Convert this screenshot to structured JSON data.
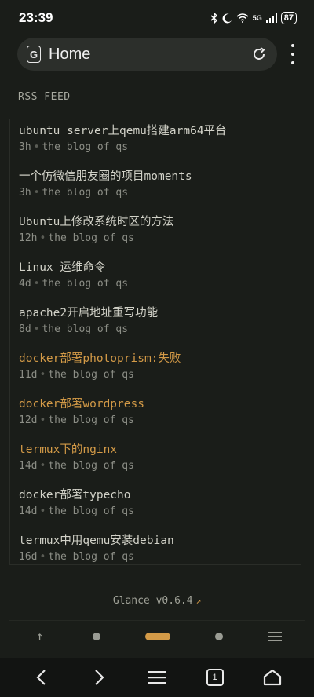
{
  "status_bar": {
    "time": "23:39",
    "network": "5G",
    "battery": "87"
  },
  "browser": {
    "url_text": "Home",
    "site_icon_letter": "G"
  },
  "section": {
    "title": "RSS FEED"
  },
  "feed": {
    "items": [
      {
        "title": "ubuntu server上qemu搭建arm64平台",
        "age": "3h",
        "source": "the blog of qs",
        "visited": false
      },
      {
        "title": "一个仿微信朋友圈的项目moments",
        "age": "3h",
        "source": "the blog of qs",
        "visited": false
      },
      {
        "title": "Ubuntu上修改系统时区的方法",
        "age": "12h",
        "source": "the blog of qs",
        "visited": false
      },
      {
        "title": "Linux 运维命令",
        "age": "4d",
        "source": "the blog of qs",
        "visited": false
      },
      {
        "title": "apache2开启地址重写功能",
        "age": "8d",
        "source": "the blog of qs",
        "visited": false
      },
      {
        "title": "docker部署photoprism:失败",
        "age": "11d",
        "source": "the blog of qs",
        "visited": true
      },
      {
        "title": "docker部署wordpress",
        "age": "12d",
        "source": "the blog of qs",
        "visited": true
      },
      {
        "title": "termux下的nginx",
        "age": "14d",
        "source": "the blog of qs",
        "visited": true
      },
      {
        "title": "docker部署typecho",
        "age": "14d",
        "source": "the blog of qs",
        "visited": false
      },
      {
        "title": "termux中用qemu安装debian",
        "age": "16d",
        "source": "the blog of qs",
        "visited": false
      }
    ],
    "separator": "•"
  },
  "footer": {
    "version": "Glance v0.6.4",
    "link_arrow": "↗"
  },
  "colors": {
    "background": "#1a1d19",
    "accent": "#d39a47",
    "text": "#d2d2c8",
    "muted": "#8c8e86"
  }
}
